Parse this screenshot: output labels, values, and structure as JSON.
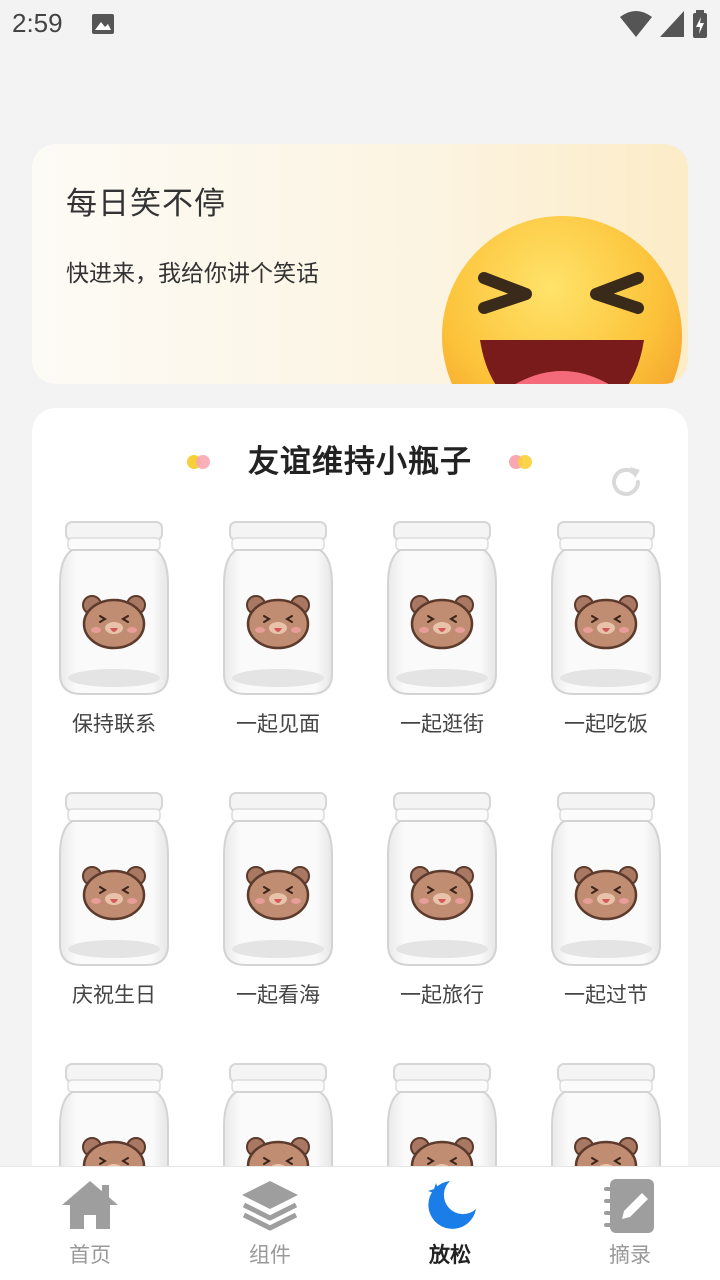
{
  "status_bar": {
    "time": "2:59"
  },
  "joke_banner": {
    "title": "每日笑不停",
    "subtitle": "快进来，我给你讲个笑话"
  },
  "bottle_section": {
    "title": "友谊维持小瓶子",
    "bottles": [
      {
        "label": "保持联系"
      },
      {
        "label": "一起见面"
      },
      {
        "label": "一起逛街"
      },
      {
        "label": "一起吃饭"
      },
      {
        "label": "庆祝生日"
      },
      {
        "label": "一起看海"
      },
      {
        "label": "一起旅行"
      },
      {
        "label": "一起过节"
      },
      {
        "label": ""
      },
      {
        "label": ""
      },
      {
        "label": ""
      },
      {
        "label": ""
      }
    ]
  },
  "bottom_nav": {
    "items": [
      {
        "label": "首页",
        "icon": "home-icon"
      },
      {
        "label": "组件",
        "icon": "layers-icon"
      },
      {
        "label": "放松",
        "icon": "moon-icon",
        "active": true
      },
      {
        "label": "摘录",
        "icon": "notebook-icon"
      }
    ]
  },
  "colors": {
    "accent": "#1a7de8",
    "nav_inactive": "#999999",
    "banner_bg": "#fcf1d6"
  }
}
